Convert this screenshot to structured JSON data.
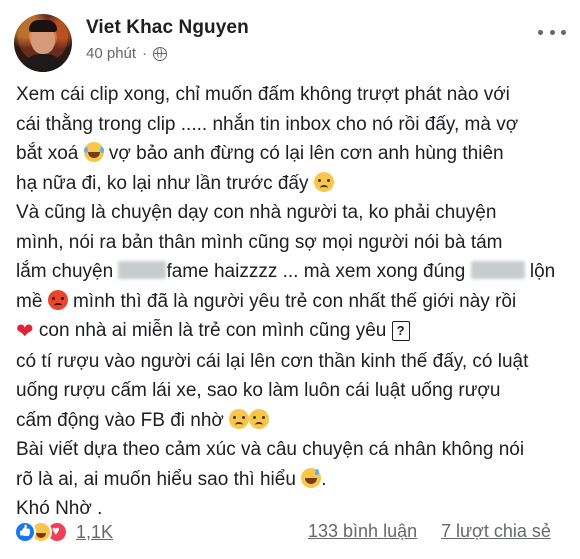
{
  "post": {
    "author": "Viet Khac Nguyen",
    "time": "40 phút",
    "separator": "·",
    "privacy_icon": "globe-icon",
    "lines": [
      [
        "Xem cái clip xong, chỉ muốn đấm không trượt phát nào với"
      ],
      [
        "cái thằng trong clip .....  nhắn tin inbox cho nó rồi đấy, mà vợ"
      ],
      [
        "bắt xoá ",
        {
          "emoji": "laugh"
        },
        " vợ bảo anh đừng có lại lên cơn anh hùng thiên"
      ],
      [
        "hạ nữa đi, ko lại như lần trước đấy ",
        {
          "emoji": "sad"
        }
      ],
      [
        "Và cũng là chuyện  dạy con  nhà người ta, ko phải chuyện"
      ],
      [
        "mình, nói ra bản thân mình cũng sợ mọi người nói bà tám"
      ],
      [
        "lắm chuyện ",
        {
          "blur": 48
        },
        "fame haizzzz ...  mà xem xong đúng ",
        {
          "blur": 54
        },
        " lộn"
      ],
      [
        "mề ",
        {
          "emoji": "angry"
        },
        "  mình thì đã là người yêu trẻ con nhất thế giới này rồi"
      ],
      [
        {
          "heart": "❤"
        },
        "  con nhà ai miễn là trẻ con   mình cũng yêu ",
        {
          "qbox": "?"
        }
      ],
      [
        "có tí rượu vào người cái lại lên cơn thần kinh thế đấy, có luật"
      ],
      [
        "uống rượu cấm lái xe, sao ko làm luôn cái luật uống rượu"
      ],
      [
        "cấm động vào FB đi nhờ ",
        {
          "emoji": "sad"
        },
        {
          "emoji": "sad"
        }
      ],
      [
        "Bài viết dựa theo cảm xúc và câu chuyện cá nhân không nói"
      ],
      [
        "rõ là ai, ai muốn hiểu sao thì hiểu ",
        {
          "emoji": "sweat"
        },
        "."
      ],
      [
        "Khó Nhờ ."
      ]
    ]
  },
  "footer": {
    "reaction_icons": [
      "like-icon",
      "haha-icon",
      "love-icon"
    ],
    "reaction_count": "1,1K",
    "comments": "133 bình luận",
    "shares": "7 lượt chia sẻ"
  },
  "colors": {
    "text": "#1c1e21",
    "secondary": "#65676b",
    "like": "#1877f2",
    "love": "#f33e58",
    "haha": "#f7c64a"
  }
}
